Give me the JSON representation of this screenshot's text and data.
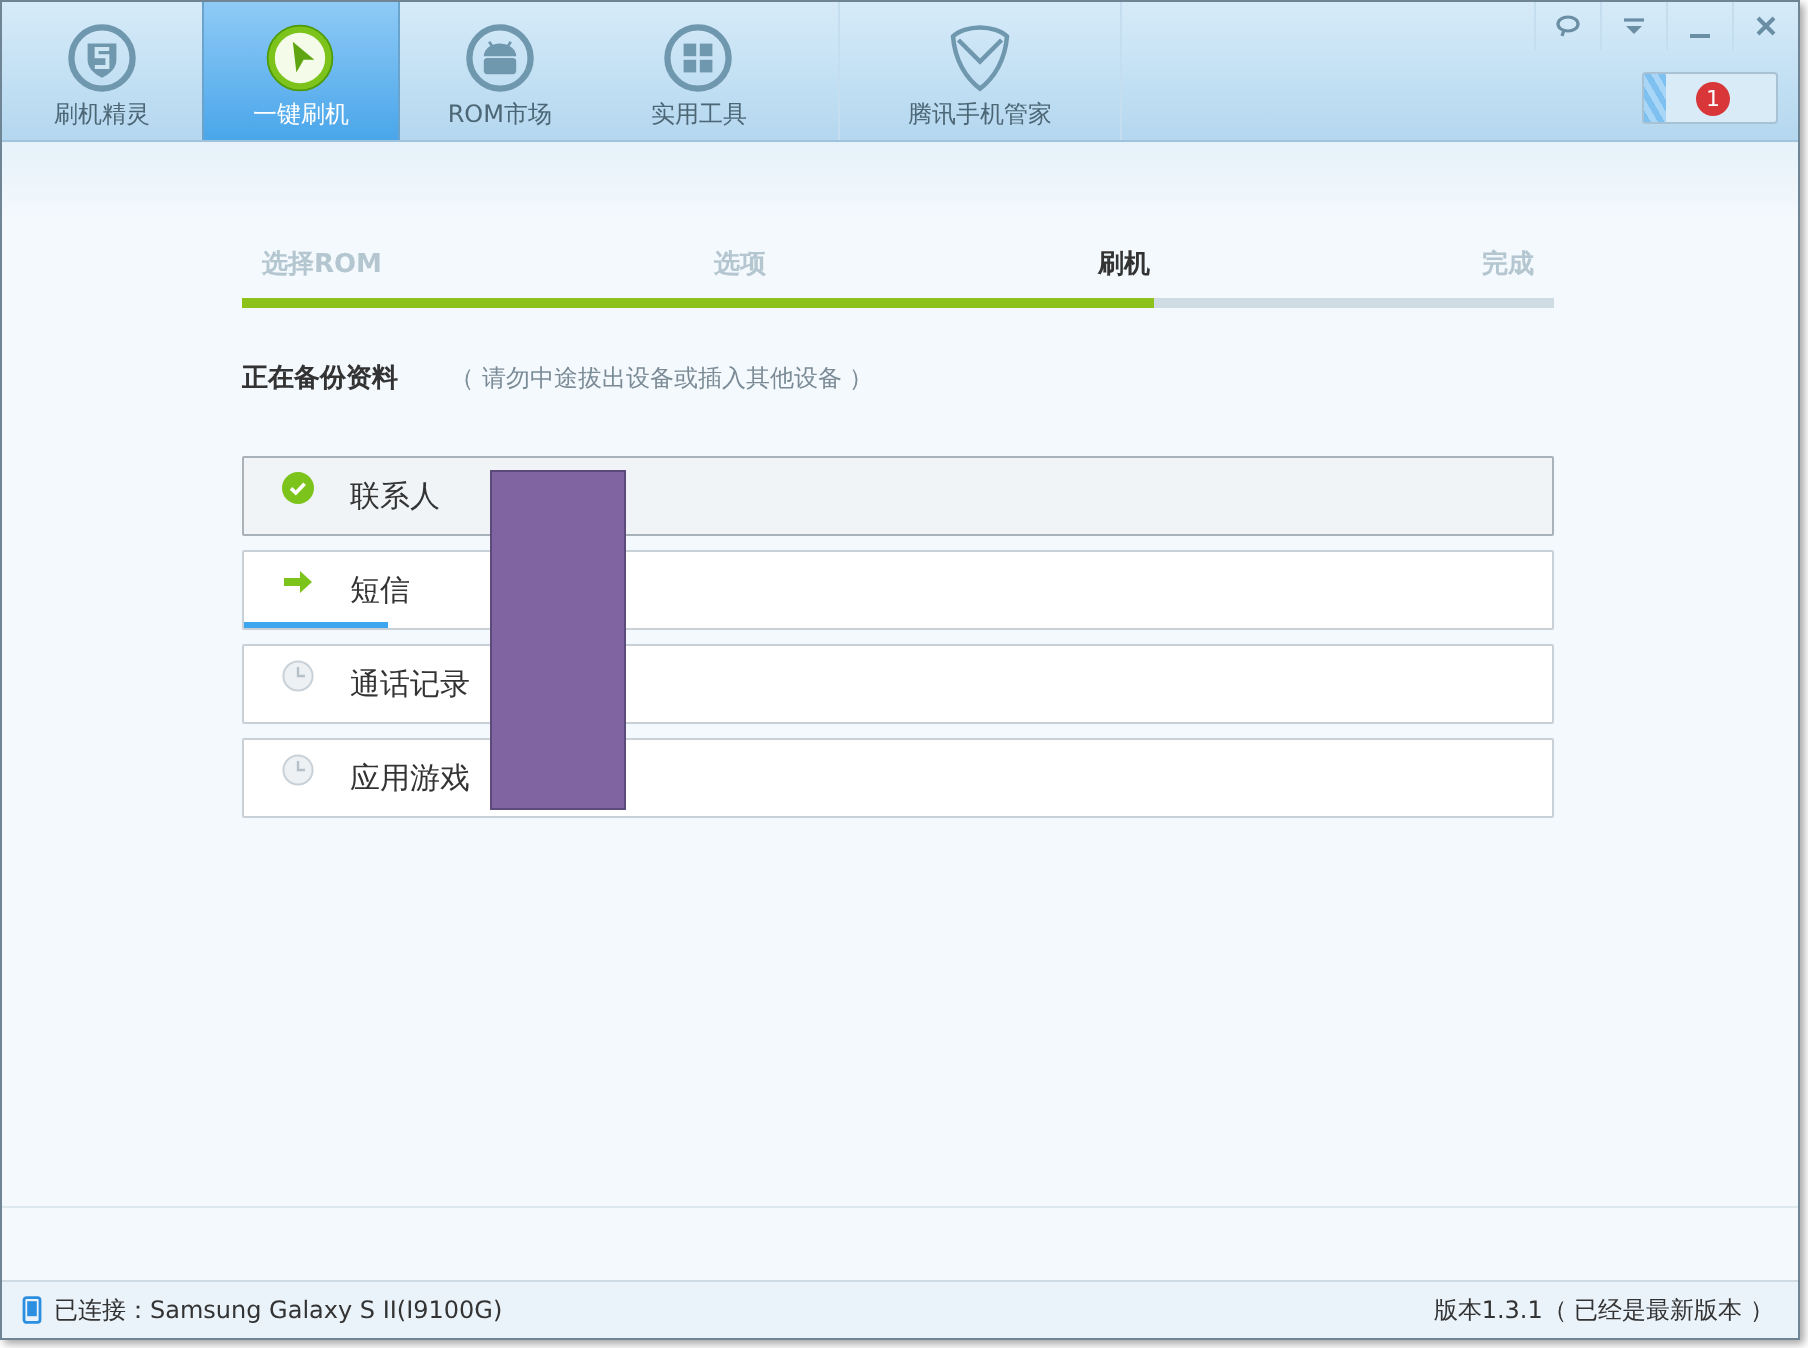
{
  "tabs": [
    {
      "label": "刷机精灵",
      "selected": false
    },
    {
      "label": "一键刷机",
      "selected": true
    },
    {
      "label": "ROM市场",
      "selected": false
    },
    {
      "label": "实用工具",
      "selected": false
    },
    {
      "label": "腾讯手机管家",
      "selected": false
    }
  ],
  "notification_count": "1",
  "steps": [
    {
      "label": "选择ROM",
      "selected": false
    },
    {
      "label": "选项",
      "selected": false
    },
    {
      "label": "刷机",
      "selected": true
    },
    {
      "label": "完成",
      "selected": false
    }
  ],
  "step_progress": {
    "level": 0.695
  },
  "task": {
    "title": "正在备份资料",
    "hint": "（ 请勿中途拔出设备或插入其他设备 ）"
  },
  "items": [
    {
      "label": "联系人",
      "kind": "done",
      "highlighted": true
    },
    {
      "label": "短信",
      "kind": "current",
      "highlighted": false,
      "level": 0.11
    },
    {
      "label": "通话记录",
      "kind": "pending",
      "highlighted": false
    },
    {
      "label": "应用游戏",
      "kind": "pending",
      "highlighted": false
    }
  ],
  "status_bar": {
    "connection": "已连接：Samsung Galaxy S II(I9100G)",
    "version": "版本1.3.1（ 已经是最新版本 ）"
  }
}
